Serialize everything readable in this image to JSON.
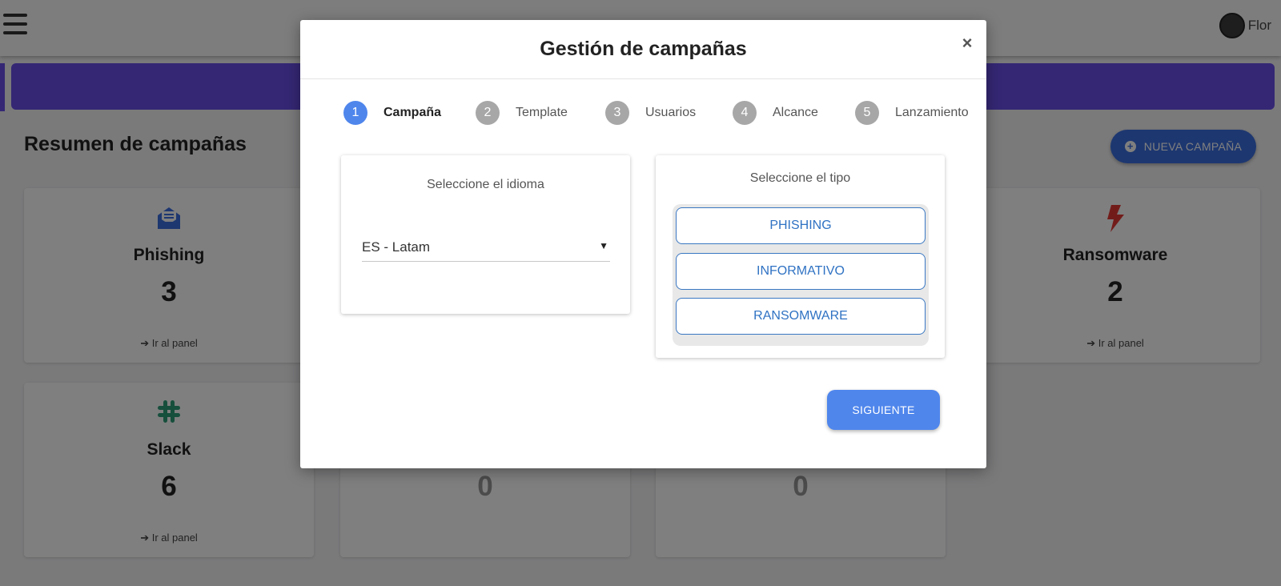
{
  "header": {
    "user_name": "Flor"
  },
  "main": {
    "section_title": "Resumen de campañas",
    "new_campaign_label": "NUEVA CAMPAÑA",
    "cards": [
      {
        "title": "Phishing",
        "count": "3",
        "link": "Ir al panel",
        "icon": "envelope-open-icon",
        "icon_color": "#3b6fe0"
      },
      {
        "title": "Ransomware",
        "count": "2",
        "link": "Ir al panel",
        "icon": "bolt-icon",
        "icon_color": "#e53935"
      },
      {
        "title": "Slack",
        "count": "6",
        "link": "Ir al panel",
        "icon": "slack-icon",
        "icon_color": "#2e9e7a"
      },
      {
        "title": "",
        "count": "0",
        "link": ""
      },
      {
        "title": "",
        "count": "0",
        "link": ""
      }
    ]
  },
  "modal": {
    "title": "Gestión de campañas",
    "close_label": "×",
    "steps": [
      {
        "number": "1",
        "label": "Campaña",
        "active": true
      },
      {
        "number": "2",
        "label": "Template",
        "active": false
      },
      {
        "number": "3",
        "label": "Usuarios",
        "active": false
      },
      {
        "number": "4",
        "label": "Alcance",
        "active": false
      },
      {
        "number": "5",
        "label": "Lanzamiento",
        "active": false
      }
    ],
    "language_panel": {
      "title": "Seleccione el idioma",
      "selected": "ES - Latam",
      "caret": "▼"
    },
    "type_panel": {
      "title": "Seleccione el tipo",
      "options": [
        "PHISHING",
        "INFORMATIVO",
        "RANSOMWARE"
      ]
    },
    "next_label": "SIGUIENTE"
  },
  "colors": {
    "accent": "#4f86ec",
    "banner": "#6b4fe8",
    "type_option": "#2f72c3"
  }
}
